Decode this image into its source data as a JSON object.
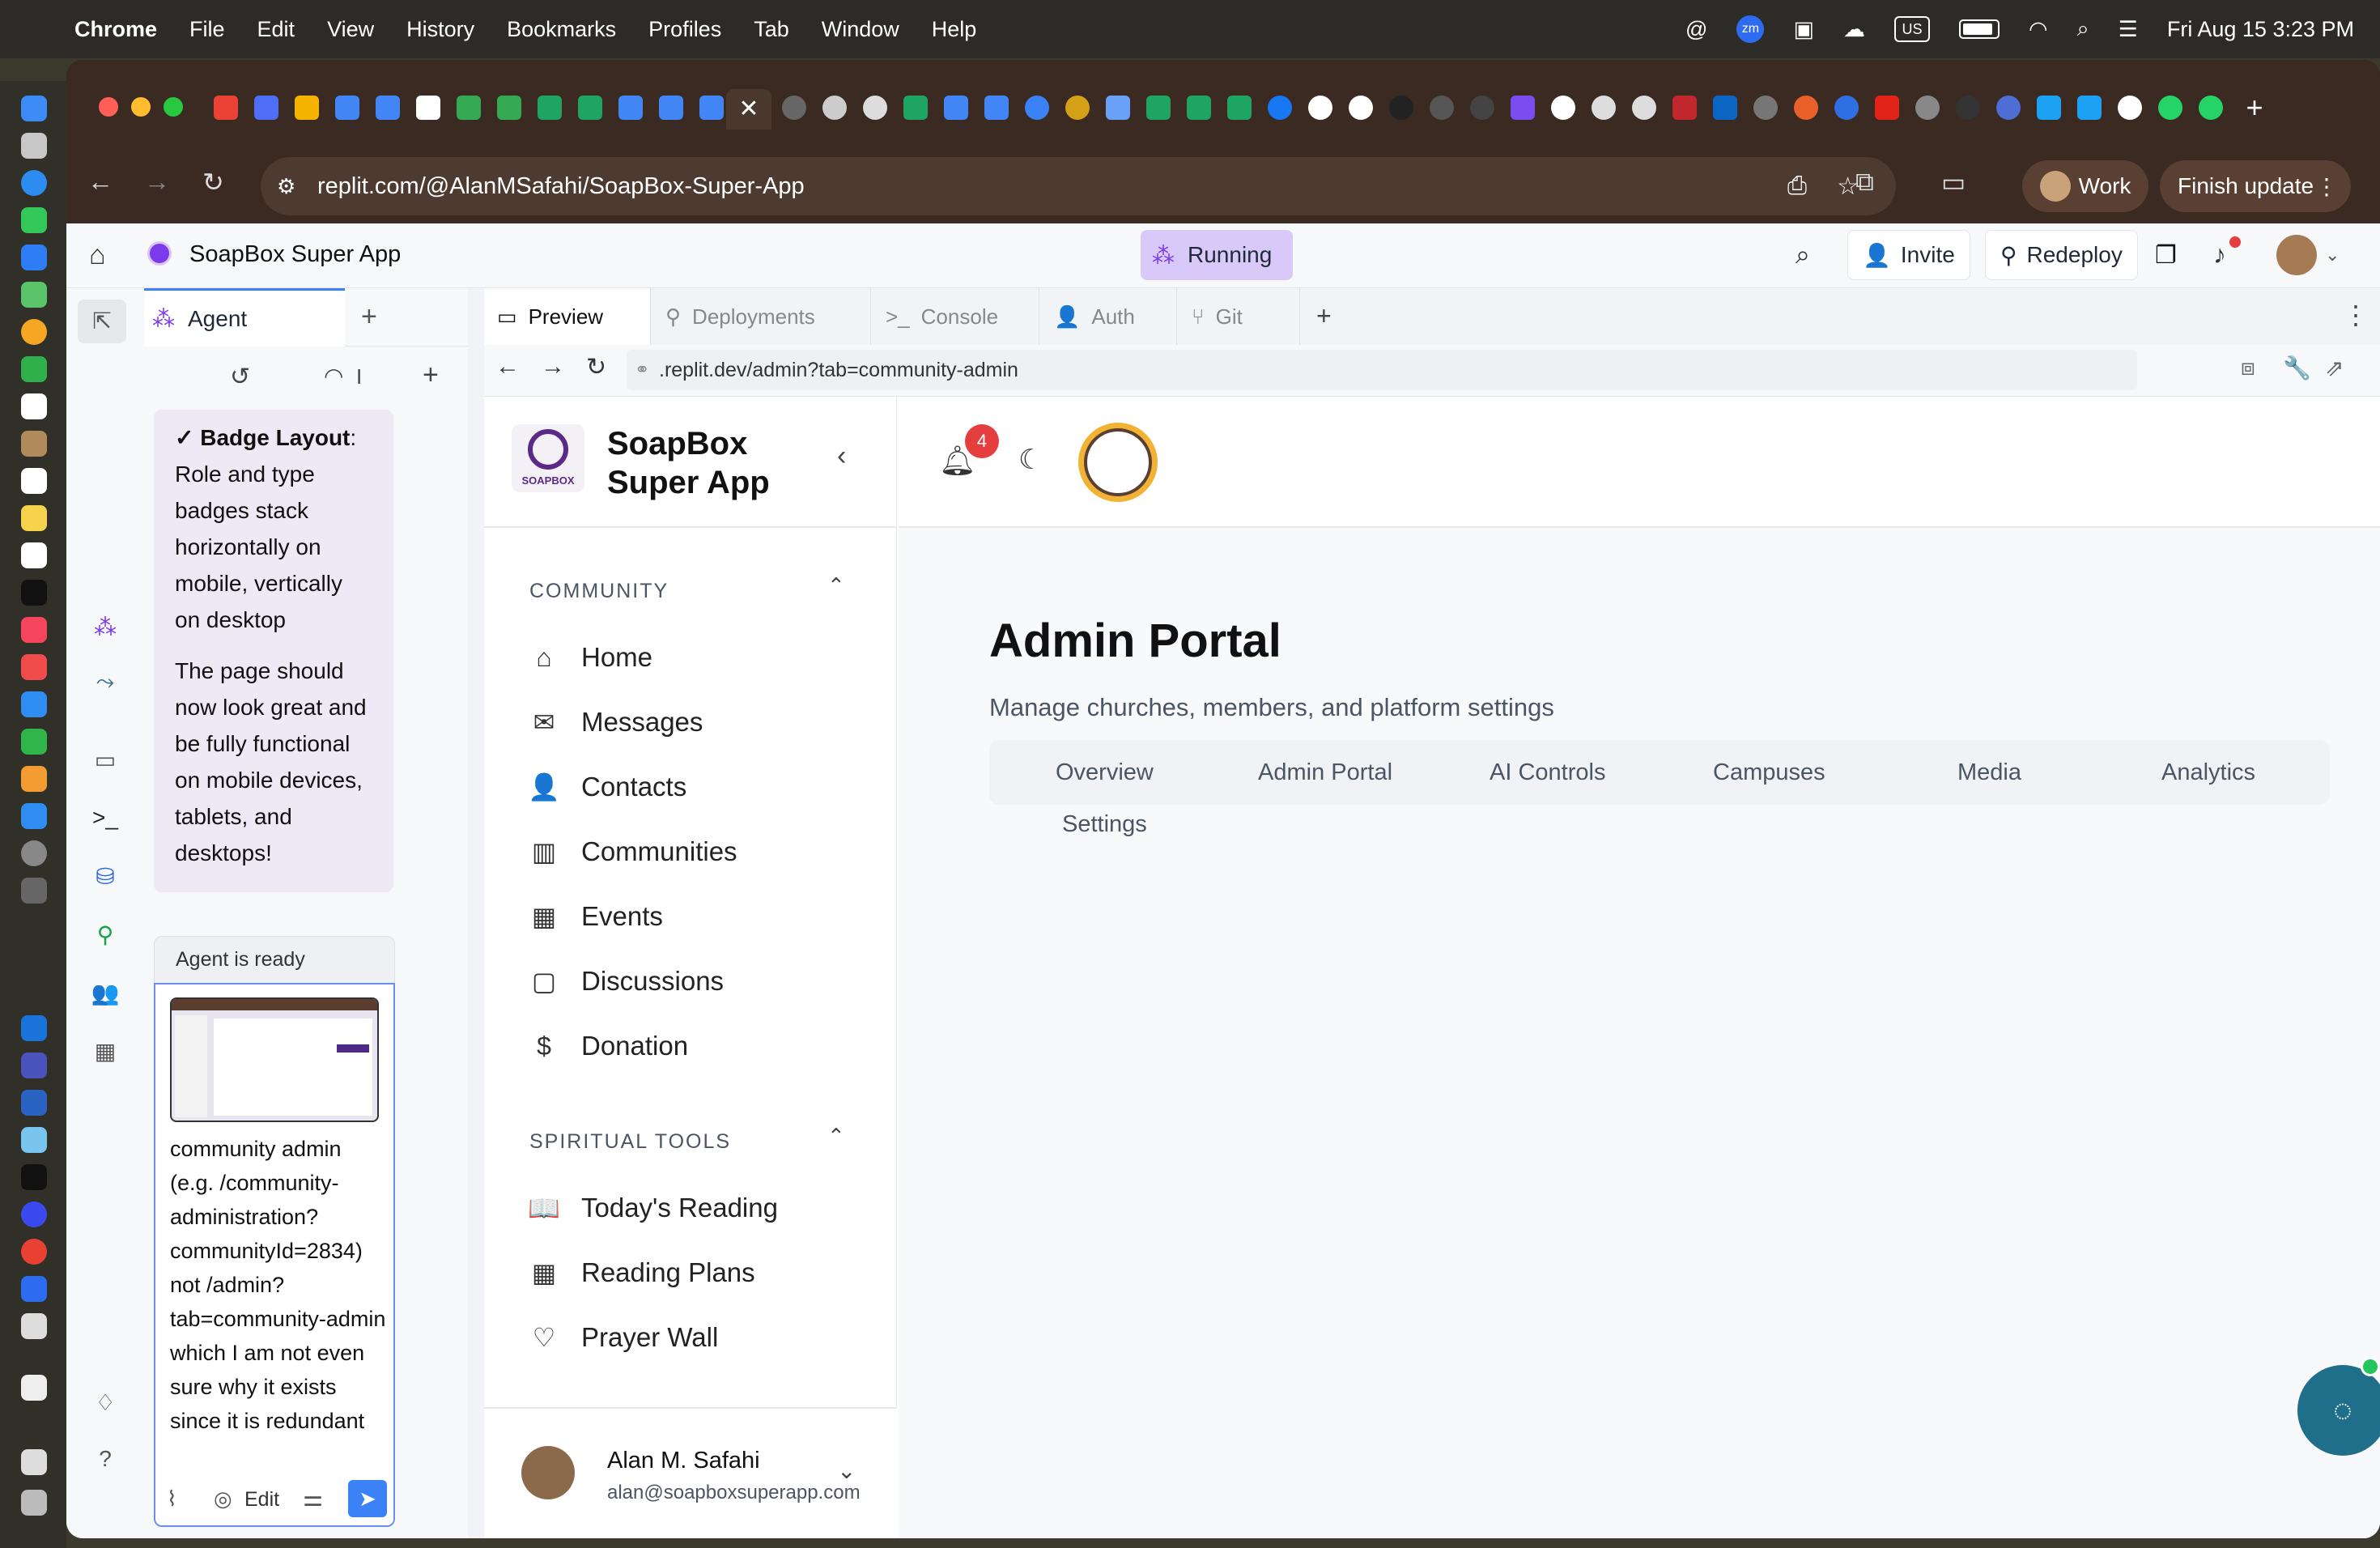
{
  "menubar": {
    "app_name": "Chrome",
    "menus": [
      "File",
      "Edit",
      "View",
      "History",
      "Bookmarks",
      "Profiles",
      "Tab",
      "Window",
      "Help"
    ],
    "keyboard": "US",
    "zoom_badge": "zm",
    "datetime": "Fri Aug 15  3:23 PM"
  },
  "browser": {
    "url": "replit.com/@AlanMSafahi/SoapBox-Super-App",
    "profile_label": "Work",
    "finish_update_label": "Finish update"
  },
  "replit": {
    "project_name": "SoapBox Super App",
    "status": "Running",
    "invite_label": "Invite",
    "redeploy_label": "Redeploy"
  },
  "agent": {
    "tab_label": "Agent",
    "usage_label": "I",
    "chat": {
      "check": "✓",
      "heading": "Badge Layout",
      "after_heading": ":",
      "text1": "Role and type badges stack horizontally on mobile, vertically on desktop",
      "text2": "The page should now look great and be fully functional on mobile devices, tablets, and desktops!"
    },
    "status": "Agent is ready",
    "composer_text": "community admin (e.g. /community-administration?communityId=2834) not /admin?tab=community-admin which I am not even sure why it exists since it is redundant",
    "edit_label": "Edit"
  },
  "preview": {
    "tabs": [
      "Preview",
      "Deployments",
      "Console",
      "Auth",
      "Git"
    ],
    "url_prefix": ".replit.dev",
    "url_path": "/admin?tab=community-admin"
  },
  "soapbox": {
    "brand_line1": "SoapBox",
    "brand_line2": "Super App",
    "logo_text": "SOAPBOX",
    "notification_count": "4",
    "section_community": "COMMUNITY",
    "community_items": [
      "Home",
      "Messages",
      "Contacts",
      "Communities",
      "Events",
      "Discussions",
      "Donation"
    ],
    "section_spiritual": "SPIRITUAL TOOLS",
    "spiritual_items": [
      "Today's Reading",
      "Reading Plans",
      "Prayer Wall"
    ],
    "user_name": "Alan M. Safahi",
    "user_email": "alan@soapboxsuperapp.com",
    "page_title": "Admin Portal",
    "page_subtitle": "Manage churches, members, and platform settings",
    "admin_tabs": [
      "Overview",
      "Admin Portal",
      "AI Controls",
      "Campuses",
      "Media",
      "Analytics",
      "Settings"
    ]
  },
  "colors": {
    "accent_purple": "#d8c9f9",
    "soapbox_purple": "#5b2a86",
    "notification_red": "#e53e3e",
    "chat_fab": "#1f6f8b"
  }
}
